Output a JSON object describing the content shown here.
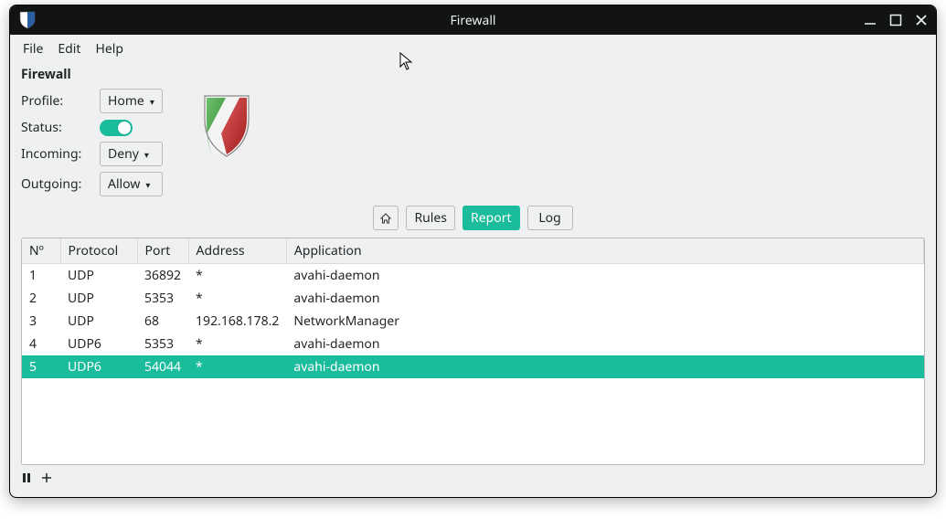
{
  "window": {
    "title": "Firewall"
  },
  "menubar": {
    "items": [
      "File",
      "Edit",
      "Help"
    ]
  },
  "section": {
    "title": "Firewall"
  },
  "settings": {
    "profile_label": "Profile:",
    "profile_value": "Home",
    "status_label": "Status:",
    "status_on": true,
    "incoming_label": "Incoming:",
    "incoming_value": "Deny",
    "outgoing_label": "Outgoing:",
    "outgoing_value": "Allow"
  },
  "tabs": {
    "home_icon": "home",
    "rules": "Rules",
    "report": "Report",
    "log": "Log",
    "active": "report"
  },
  "table": {
    "headers": [
      "Nº",
      "Protocol",
      "Port",
      "Address",
      "Application"
    ],
    "rows": [
      {
        "n": "1",
        "protocol": "UDP",
        "port": "36892",
        "address": "*",
        "application": "avahi-daemon",
        "selected": false
      },
      {
        "n": "2",
        "protocol": "UDP",
        "port": "5353",
        "address": "*",
        "application": "avahi-daemon",
        "selected": false
      },
      {
        "n": "3",
        "protocol": "UDP",
        "port": "68",
        "address": "192.168.178.2",
        "application": "NetworkManager",
        "selected": false
      },
      {
        "n": "4",
        "protocol": "UDP6",
        "port": "5353",
        "address": "*",
        "application": "avahi-daemon",
        "selected": false
      },
      {
        "n": "5",
        "protocol": "UDP6",
        "port": "54044",
        "address": "*",
        "application": "avahi-daemon",
        "selected": true
      }
    ]
  },
  "footer": {
    "pause": "pause",
    "add": "add"
  }
}
